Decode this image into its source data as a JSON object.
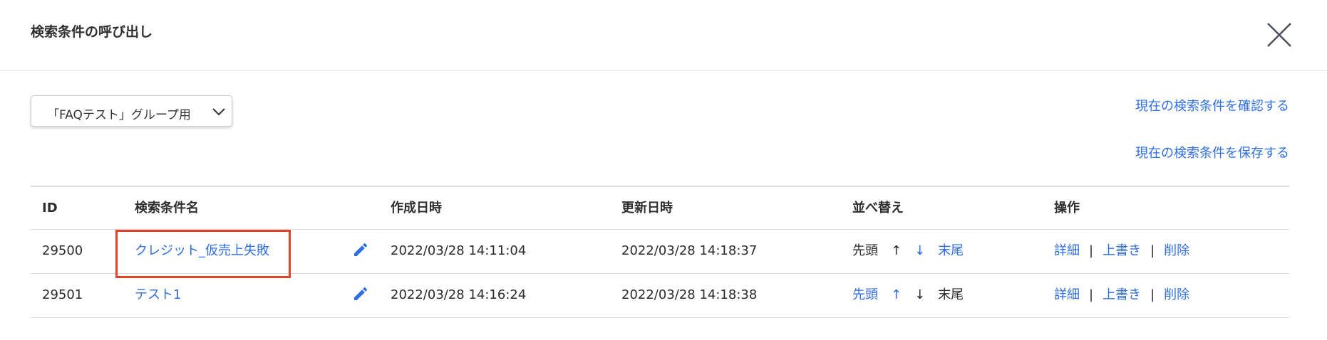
{
  "dialog": {
    "title": "検索条件の呼び出し",
    "close_icon": "close-icon"
  },
  "group_select": {
    "value": "「FAQテスト」グループ用"
  },
  "links": {
    "confirm": "現在の検索条件を確認する",
    "save": "現在の検索条件を保存する"
  },
  "table": {
    "headers": [
      "ID",
      "検索条件名",
      "作成日時",
      "更新日時",
      "並べ替え",
      "操作"
    ],
    "rows": [
      {
        "id": "29500",
        "name": "クレジット_仮売上失敗",
        "created": "2022/03/28 14:11:04",
        "updated": "2022/03/28 14:18:37",
        "sort_top": "先頭",
        "sort_up": "↑",
        "sort_down": "↓",
        "sort_bottom": "末尾",
        "op_detail": "詳細",
        "op_overwrite": "上書き",
        "op_delete": "削除",
        "sep": "|"
      },
      {
        "id": "29501",
        "name": "テスト1",
        "created": "2022/03/28 14:16:24",
        "updated": "2022/03/28 14:18:38",
        "sort_top": "先頭",
        "sort_up": "↑",
        "sort_down": "↓",
        "sort_bottom": "末尾",
        "op_detail": "詳細",
        "op_overwrite": "上書き",
        "op_delete": "削除",
        "sep": "|"
      }
    ]
  },
  "colors": {
    "link": "#2f6ee0",
    "highlight": "#e0442c",
    "text": "#2b2b2b"
  }
}
